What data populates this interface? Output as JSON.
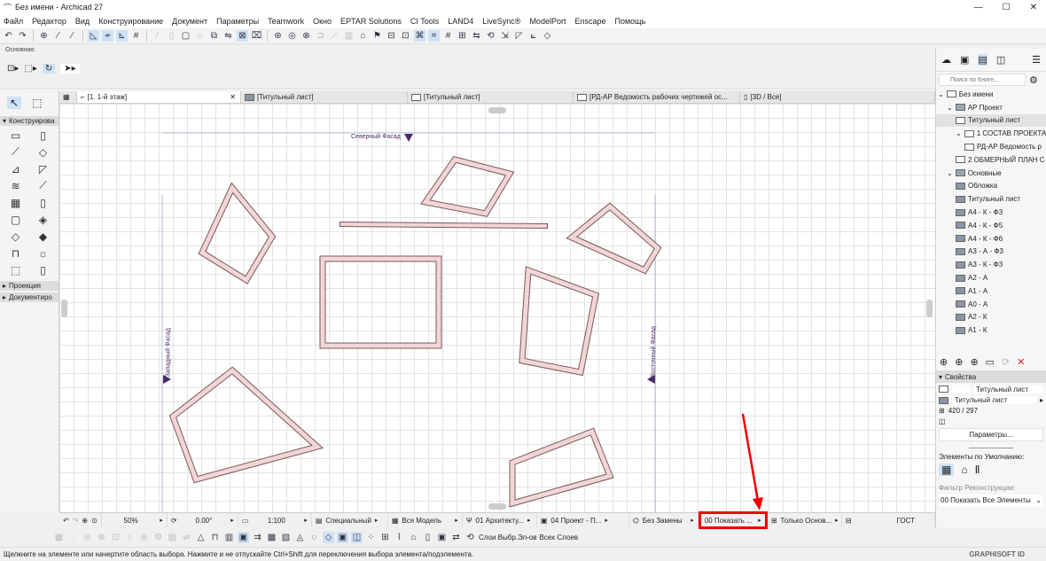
{
  "window": {
    "title": "Без имени - Archicad 27"
  },
  "menu": [
    "Файл",
    "Редактор",
    "Вид",
    "Конструирование",
    "Документ",
    "Параметры",
    "Teamwork",
    "Окно",
    "EPTAR Solutions",
    "CI Tools",
    "LAND4",
    "LiveSync®",
    "ModelPort",
    "Enscape",
    "Помощь"
  ],
  "toolbar_icons": [
    "undo-icon",
    "redo-icon",
    "find-select-icon",
    "eyedropper-icon",
    "syringe-icon",
    "ruler-icon",
    "guide-line-icon",
    "snap-guide-icon",
    "grid-icon",
    "pen-icon",
    "wall-icon",
    "layer-icon",
    "lock-icon",
    "group-icon",
    "trim-icon",
    "intersect-icon",
    "offset-icon",
    "multiply-icon",
    "adjust-icon",
    "magic-wand-icon",
    "split-icon",
    "fillet-icon",
    "curve-icon",
    "flag-icon",
    "drawing-icon",
    "drawing-frame-icon",
    "fit-icon",
    "align-icon",
    "distribute-icon",
    "grid-snap-icon",
    "snap-points-icon",
    "mirror-icon",
    "rotate-icon",
    "stretch-icon",
    "cursor-snap-icon",
    "measure-icon",
    "publish-icon"
  ],
  "infobox": {
    "label": "Основная:"
  },
  "tabs": [
    {
      "label": "[1. 1-й этаж]"
    },
    {
      "label": "[Титульный лист]"
    },
    {
      "label": "[Титульный лист]"
    },
    {
      "label": "[РД-АР Ведомость рабочих чертежей ос..."
    },
    {
      "label": "[3D / Все]"
    }
  ],
  "toolbox": {
    "sections": {
      "design": "Конструирова",
      "projection": "Проекция",
      "documentation": "Документиро"
    },
    "tools": [
      "wall-tool-icon",
      "column-tool-icon",
      "beam-tool-icon",
      "slab-tool-icon",
      "roof-tool-icon",
      "shell-tool-icon",
      "stair-tool-icon",
      "railing-tool-icon",
      "curtain-wall-tool-icon",
      "door-tool-icon",
      "window-tool-icon",
      "skylight-tool-icon",
      "mesh-tool-icon",
      "morph-tool-icon",
      "object-tool-icon",
      "lamp-tool-icon",
      "zone-tool-icon",
      "opening-tool-icon"
    ]
  },
  "canvas": {
    "north": "Северный Фасад",
    "west": "Западный Фасад",
    "east": "Восточный Фасад"
  },
  "navigator": {
    "search_placeholder": "Поиск по Книге...",
    "items": [
      {
        "label": "Без имени",
        "lvl": 0,
        "type": "book"
      },
      {
        "label": "АР Проект",
        "lvl": 1,
        "type": "folder"
      },
      {
        "label": "Титульный лист",
        "lvl": 2,
        "type": "sheet",
        "selected": true
      },
      {
        "label": "1 СОСТАВ ПРОЕКТА",
        "lvl": 2,
        "type": "sheet"
      },
      {
        "label": "РД-АР Ведомость р",
        "lvl": 3,
        "type": "sheet"
      },
      {
        "label": "2 ОБМЕРНЫЙ ПЛАН С",
        "lvl": 2,
        "type": "sheet"
      },
      {
        "label": "Основные",
        "lvl": 1,
        "type": "folder"
      },
      {
        "label": "Обложка",
        "lvl": 2,
        "type": "darksheet"
      },
      {
        "label": "Титульный лист",
        "lvl": 2,
        "type": "darksheet"
      },
      {
        "label": "А4 - К - Ф3",
        "lvl": 2,
        "type": "darksheet"
      },
      {
        "label": "А4 - К - Ф5",
        "lvl": 2,
        "type": "darksheet"
      },
      {
        "label": "А4 - К - Ф6",
        "lvl": 2,
        "type": "darksheet"
      },
      {
        "label": "А3 - А - Ф3",
        "lvl": 2,
        "type": "darksheet"
      },
      {
        "label": "А3 - К - Ф3",
        "lvl": 2,
        "type": "darksheet"
      },
      {
        "label": "А2 - А",
        "lvl": 2,
        "type": "darksheet"
      },
      {
        "label": "А1 - А",
        "lvl": 2,
        "type": "darksheet"
      },
      {
        "label": "А0 - А",
        "lvl": 2,
        "type": "darksheet"
      },
      {
        "label": "А2 - К",
        "lvl": 2,
        "type": "darksheet"
      },
      {
        "label": "А1 - К",
        "lvl": 2,
        "type": "darksheet"
      }
    ]
  },
  "properties": {
    "title": "Свойства",
    "name": "Титульный лист",
    "layout": "Титульный лист",
    "size": "420 / 297",
    "params_button": "Параметры...",
    "defaults_label": "Элементы по Умолчанию:",
    "renovation_label": "Фильтр Реконструкции:",
    "renovation_value": "00 Показать Все Элементы"
  },
  "bottombar": {
    "zoom": "50%",
    "angle": "0.00°",
    "scale": "1:100",
    "pen_set": "Специальный",
    "model_view": "Вся Модель",
    "layer_combo": "01 Архитекту...",
    "dimension": "04 Проект - П...",
    "override": "Без Замены",
    "renovation": "00 Показать ...",
    "structure": "Только Основ...",
    "standard": "ГОСТ"
  },
  "bottomtools": {
    "layers_label": "Слои Выбр.Эл-ов",
    "all_layers_label": "Всех Слоев"
  },
  "status": {
    "text": "Щелкните на элементе или начертите область выбора. Нажмите и не отпускайте Ctrl+Shift для переключения выбора элемента/подэлемента.",
    "brand": "GRAPHISOFT ID"
  },
  "colors": {
    "accent": "#cfe2f5",
    "highlight": "#e00000",
    "marker": "#4b2a6b"
  }
}
